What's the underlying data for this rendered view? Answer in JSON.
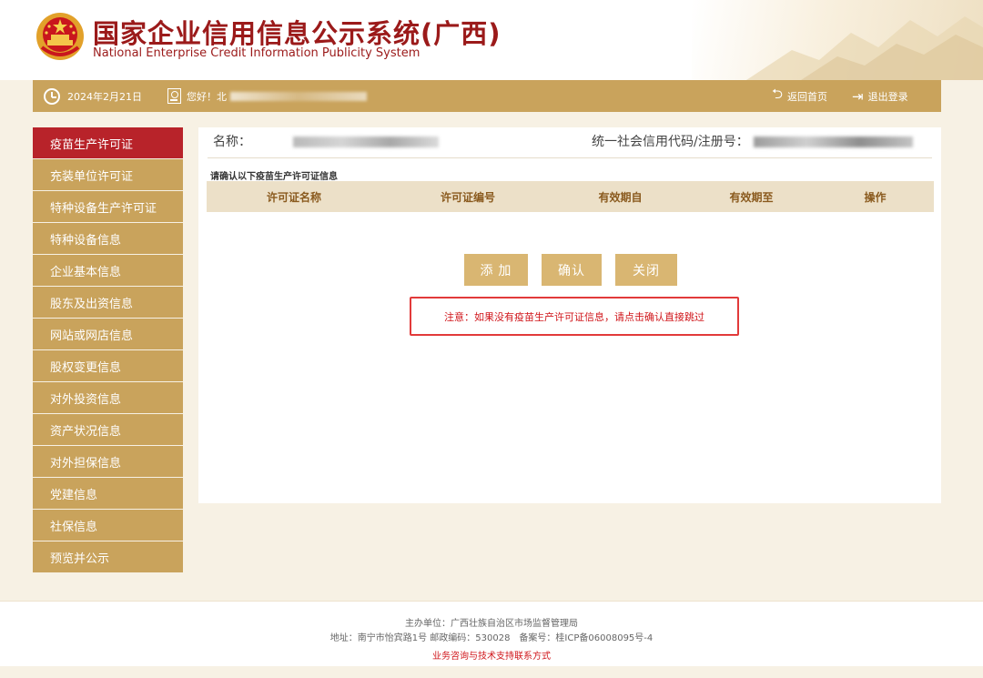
{
  "header": {
    "title_cn": "国家企业信用信息公示系统(广西)",
    "title_en": "National Enterprise Credit Information Publicity System",
    "emblem_icon": "national-emblem-icon"
  },
  "topbar": {
    "date": "2024年2月21日",
    "greeting": "您好！北",
    "home_link": "返回首页",
    "logout_link": "退出登录"
  },
  "sidebar": {
    "items": [
      {
        "label": "疫苗生产许可证",
        "active": true
      },
      {
        "label": "充装单位许可证"
      },
      {
        "label": "特种设备生产许可证"
      },
      {
        "label": "特种设备信息"
      },
      {
        "label": "企业基本信息"
      },
      {
        "label": "股东及出资信息"
      },
      {
        "label": "网站或网店信息"
      },
      {
        "label": "股权变更信息"
      },
      {
        "label": "对外投资信息"
      },
      {
        "label": "资产状况信息"
      },
      {
        "label": "对外担保信息"
      },
      {
        "label": "党建信息"
      },
      {
        "label": "社保信息"
      },
      {
        "label": "预览并公示"
      }
    ]
  },
  "main": {
    "name_label": "名称：",
    "code_label": "统一社会信用代码/注册号：",
    "confirm_tip": "请确认以下疫苗生产许可证信息",
    "table": {
      "columns": [
        "许可证名称",
        "许可证编号",
        "有效期自",
        "有效期至",
        "操作"
      ]
    },
    "buttons": {
      "add": "添 加",
      "confirm": "确认",
      "close": "关闭"
    },
    "notice": "注意：如果没有疫苗生产许可证信息，请点击确认直接跳过"
  },
  "footer": {
    "host": "主办单位：广西壮族自治区市场监督管理局",
    "address": "地址：南宁市怡宾路1号 邮政编码：530028　备案号：桂ICP备06008095号-4",
    "contact": "业务咨询与技术支持联系方式"
  },
  "colors": {
    "gold": "#c9a35c",
    "active_red": "#b8232a",
    "button_gold": "#d9b672",
    "notice_red": "#d0161b"
  }
}
